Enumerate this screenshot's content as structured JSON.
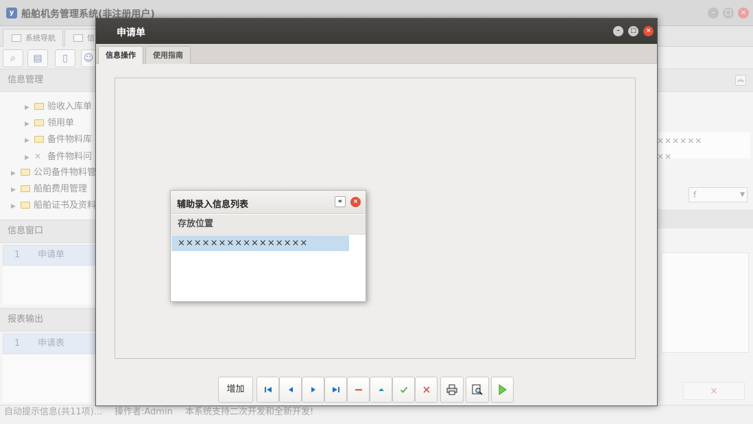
{
  "app": {
    "title": "船舶机务管理系统(非注册用户)",
    "logo_text": "y"
  },
  "bg_tabs": [
    {
      "label": "系统导航"
    },
    {
      "label": "信"
    }
  ],
  "panels": {
    "info_management": "信息管理",
    "info_window": "信息窗口",
    "report_output": "报表输出"
  },
  "tree": {
    "items": [
      {
        "label": "验收入库单"
      },
      {
        "label": "领用单"
      },
      {
        "label": "备件物料库"
      },
      {
        "label": "备件物料问"
      },
      {
        "label": "公司备件物料管"
      },
      {
        "label": "船舶费用管理"
      },
      {
        "label": "船舶证书及资料"
      }
    ]
  },
  "info_window_rows": [
    {
      "no": "1",
      "name": "申请单"
    }
  ],
  "report_rows": [
    {
      "no": "1",
      "name": "申请表"
    }
  ],
  "bg_right": {
    "line1": "××××××",
    "line2": "××",
    "select_value": "f",
    "x_glyph": "×"
  },
  "status": {
    "hint": "自动提示信息(共11项)...",
    "operator": "操作者:Admin",
    "notice": "本系统支持二次开发和全新开发!"
  },
  "dialog": {
    "title": "申请单",
    "tabs": [
      {
        "label": "信息操作",
        "active": true
      },
      {
        "label": "使用指南",
        "active": false
      }
    ],
    "toolbar": {
      "add_label": "增加"
    }
  },
  "popup": {
    "title": "辅助录入信息列表",
    "column": "存放位置",
    "rows": [
      {
        "value": "××××××××××××××××"
      }
    ]
  },
  "colors": {
    "dialog_title_bg": "#42413d",
    "selected_row": "#c5dcef",
    "close_red": "#e2513a",
    "nav_blue": "#1f6fc5",
    "confirm_green": "#5aaa3a",
    "cancel_red": "#d9534f"
  },
  "icons": {
    "toolbar": [
      "first-record-icon",
      "previous-record-icon",
      "next-record-icon",
      "last-record-icon",
      "delete-icon",
      "move-up-icon",
      "confirm-icon",
      "cancel-icon",
      "print-icon",
      "print-preview-icon",
      "run-icon"
    ]
  }
}
